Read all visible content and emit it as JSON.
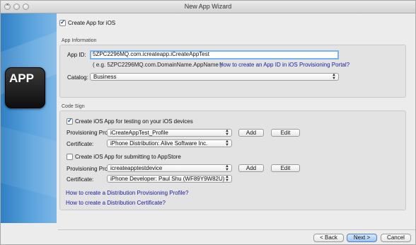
{
  "window": {
    "title": "New App Wizard"
  },
  "logo": {
    "text": "APP",
    "apple_glyph": ""
  },
  "create_ios": {
    "label": "Create App for iOS",
    "checked": true
  },
  "app_info": {
    "group_title": "App Information",
    "app_id_label": "App ID:",
    "app_id_value": "5ZPC2296MQ.com.icreateapp.iCreateAppTest",
    "example": "( e.g. 5ZPC2296MQ.com.DomainName.AppName )",
    "how_to_link": "How to create an App ID in iOS Provisioning Portal?",
    "catalog_label": "Catalog:",
    "catalog_value": "Business"
  },
  "code_sign": {
    "group_title": "Code Sign",
    "testing": {
      "label": "Create iOS App for testing on your iOS devices",
      "checked": true,
      "profile_label": "Provisioning Profile",
      "profile_value": "iCreateAppTest_Profile",
      "add": "Add",
      "edit": "Edit",
      "cert_label": "Certificate:",
      "cert_value": "iPhone Distribution: Alive Software Inc."
    },
    "appstore": {
      "label": "Create iOS App for submitting to AppStore",
      "checked": false,
      "profile_label": "Provisioning Profile",
      "profile_value": "icreateapptestdevice",
      "add": "Add",
      "edit": "Edit",
      "cert_label": "Certificate:",
      "cert_value": "iPhone Developer: Paul Shu (WF89Y9W82U)"
    },
    "link_profile": "How to create a Distribution Provisioning Profile?",
    "link_cert": "How to create a Distribution Certificate?"
  },
  "footer": {
    "back": "< Back",
    "next": "Next >",
    "cancel": "Cancel"
  }
}
